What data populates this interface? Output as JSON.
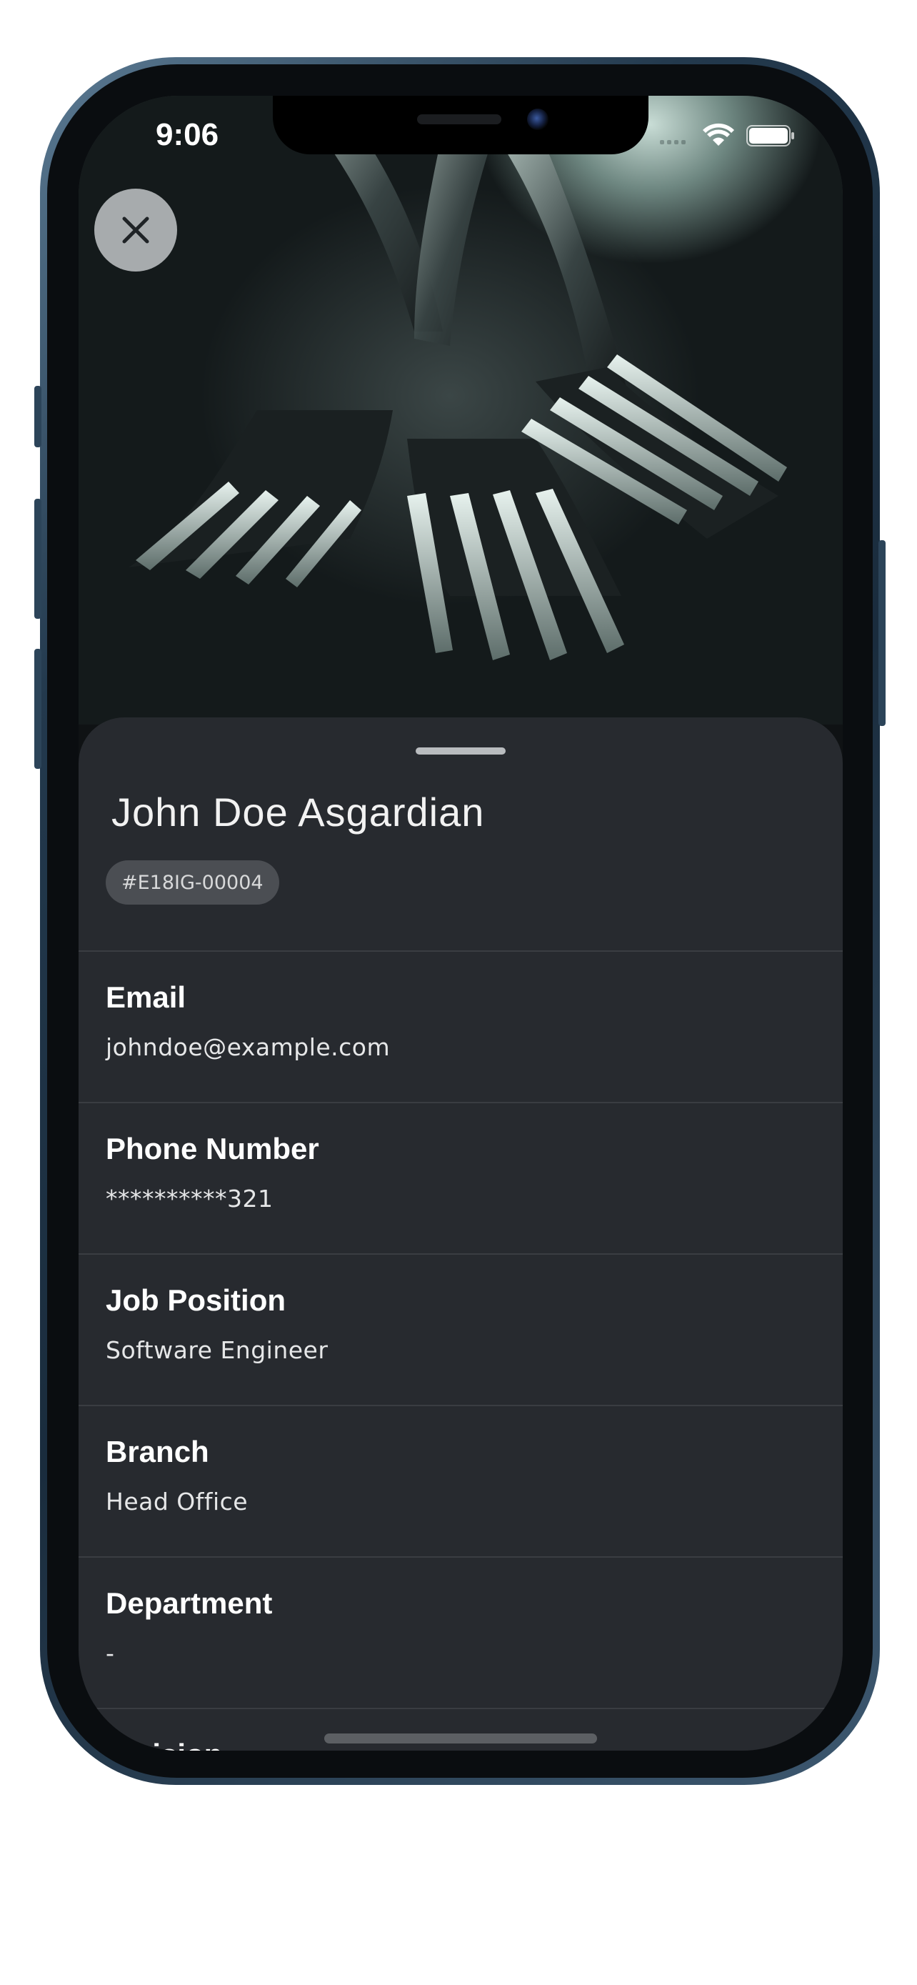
{
  "status_bar": {
    "time": "9:06"
  },
  "hero": {
    "icon": "forks-photo"
  },
  "close_button": {
    "icon": "close-icon"
  },
  "profile": {
    "name": "John Doe Asgardian",
    "employee_id": "#E18IG-00004"
  },
  "fields": [
    {
      "label": "Email",
      "value": "johndoe@example.com"
    },
    {
      "label": "Phone Number",
      "value": "**********321"
    },
    {
      "label": "Job Position",
      "value": "Software Engineer"
    },
    {
      "label": "Branch",
      "value": "Head Office"
    },
    {
      "label": "Department",
      "value": "-"
    },
    {
      "label": "Division",
      "value": ""
    }
  ],
  "colors": {
    "sheet_background": "#272a2f",
    "badge_background": "#4b4e53",
    "divider": "#3a3d42"
  }
}
